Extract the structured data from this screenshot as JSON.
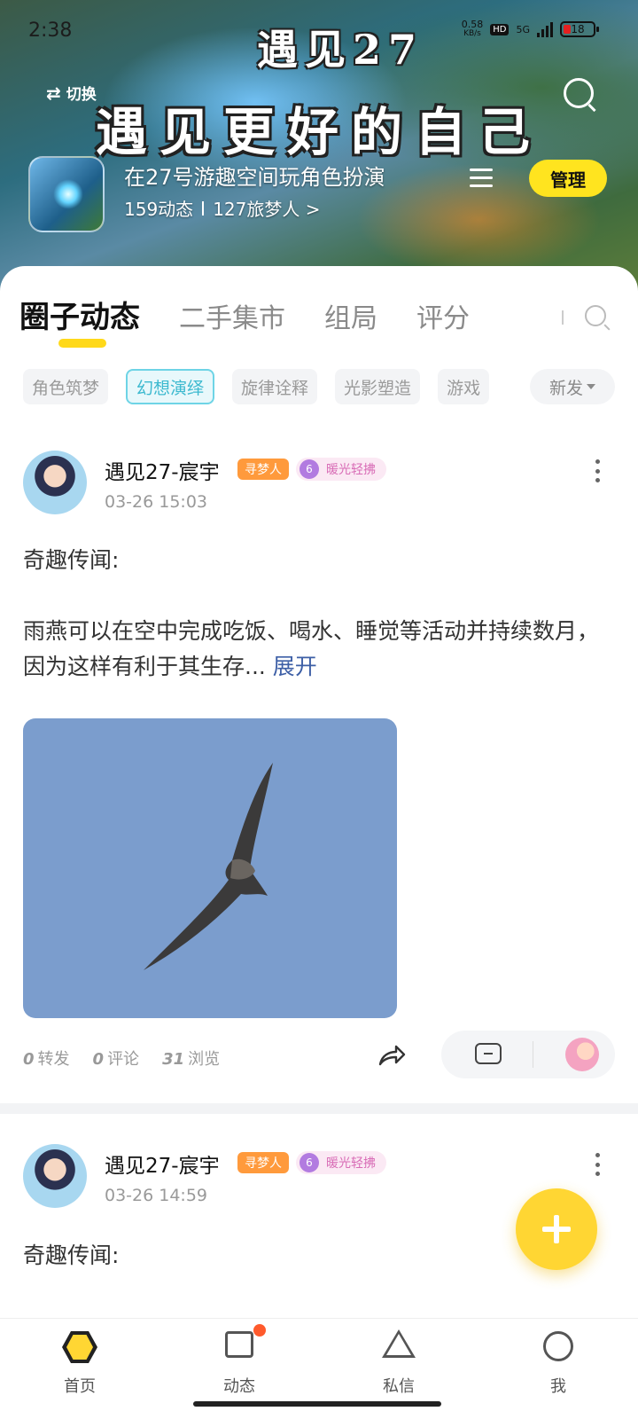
{
  "status_bar": {
    "time": "2:38",
    "net_speed": "0.58",
    "net_unit": "KB/s",
    "hd": "HD",
    "network": "5G",
    "battery": "18"
  },
  "header": {
    "banner_line1": "遇见27",
    "banner_line2": "遇见更好的自己",
    "switch_label": "切换",
    "circle_name": "在27号游趣空间玩角色扮演",
    "posts_count": "159动态",
    "members": "127旅梦人 >",
    "manage_label": "管理"
  },
  "tabs": [
    "圈子动态",
    "二手集市",
    "组局",
    "评分"
  ],
  "chips": [
    "角色筑梦",
    "幻想演绎",
    "旋律诠释",
    "光影塑造",
    "游戏"
  ],
  "active_chip": "幻想演绎",
  "sort_label": "新发",
  "posts": [
    {
      "author": "遇见27-宸宇",
      "tag": "寻梦人",
      "level": "6",
      "badge": "暖光轻拂",
      "time": "03-26 15:03",
      "title": "奇趣传闻:",
      "body": "雨燕可以在空中完成吃饭、喝水、睡觉等活动并持续数月，因为这样有利于其生存...",
      "expand": "展开",
      "reposts": "0",
      "reposts_label": "转发",
      "comments": "0",
      "comments_label": "评论",
      "views": "31",
      "views_label": "浏览"
    },
    {
      "author": "遇见27-宸宇",
      "tag": "寻梦人",
      "level": "6",
      "badge": "暖光轻拂",
      "time": "03-26 14:59",
      "title": "奇趣传闻:"
    }
  ],
  "bottom_nav": [
    "首页",
    "动态",
    "私信",
    "我"
  ]
}
